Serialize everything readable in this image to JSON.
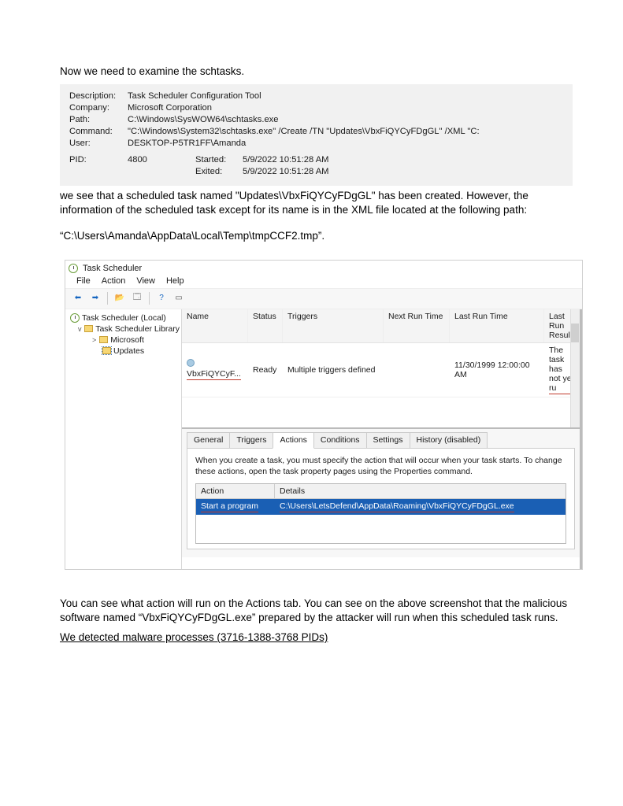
{
  "doc": {
    "intro": "Now we need to examine the schtasks.",
    "info": {
      "description_k": "Description:",
      "description_v": "Task Scheduler Configuration Tool",
      "company_k": "Company:",
      "company_v": "Microsoft Corporation",
      "path_k": "Path:",
      "path_v": "C:\\Windows\\SysWOW64\\schtasks.exe",
      "command_k": "Command:",
      "command_v": "\"C:\\Windows\\System32\\schtasks.exe\" /Create /TN \"Updates\\VbxFiQYCyFDgGL\" /XML \"C:",
      "user_k": "User:",
      "user_v": "DESKTOP-P5TR1FF\\Amanda",
      "pid_k": "PID:",
      "pid_v": "4800",
      "started_k": "Started:",
      "started_v": "5/9/2022 10:51:28 AM",
      "exited_k": "Exited:",
      "exited_v": "5/9/2022 10:51:28 AM"
    },
    "para2": "we see that a scheduled task named \"Updates\\VbxFiQYCyFDgGL\" has been created. However, the information of the scheduled task except for its name is in the XML file located at the following path:",
    "path_line": "“C:\\Users\\Amanda\\AppData\\Local\\Temp\\tmpCCF2.tmp”.",
    "post1": "You can see what action will run on the Actions tab. You can see on the above screenshot that the malicious software named “VbxFiQYCyFDgGL.exe” prepared by the attacker will run when this scheduled task runs.",
    "post2": "We detected malware processes (3716-1388-3768 PIDs)"
  },
  "ts": {
    "title": "Task Scheduler",
    "menu": {
      "file": "File",
      "action": "Action",
      "view": "View",
      "help": "Help"
    },
    "tree": {
      "root": "Task Scheduler (Local)",
      "lib": "Task Scheduler Library",
      "ms": "Microsoft",
      "updates": "Updates"
    },
    "list": {
      "cols": {
        "name": "Name",
        "status": "Status",
        "trig": "Triggers",
        "next": "Next Run Time",
        "last": "Last Run Time",
        "res": "Last Run Result"
      },
      "row": {
        "name": "VbxFiQYCyF...",
        "status": "Ready",
        "trig": "Multiple triggers defined",
        "next": "",
        "last": "11/30/1999 12:00:00 AM",
        "res": "The task has not yet ru"
      }
    },
    "tabs": {
      "general": "General",
      "triggers": "Triggers",
      "actions": "Actions",
      "conditions": "Conditions",
      "settings": "Settings",
      "history": "History (disabled)"
    },
    "pane_hint": "When you create a task, you must specify the action that will occur when your task starts.  To change these actions, open the task property pages using the Properties command.",
    "actions_table": {
      "cols": {
        "action": "Action",
        "details": "Details"
      },
      "row": {
        "action": "Start a program",
        "details": "C:\\Users\\LetsDefend\\AppData\\Roaming\\VbxFiQYCyFDgGL.exe"
      }
    }
  }
}
